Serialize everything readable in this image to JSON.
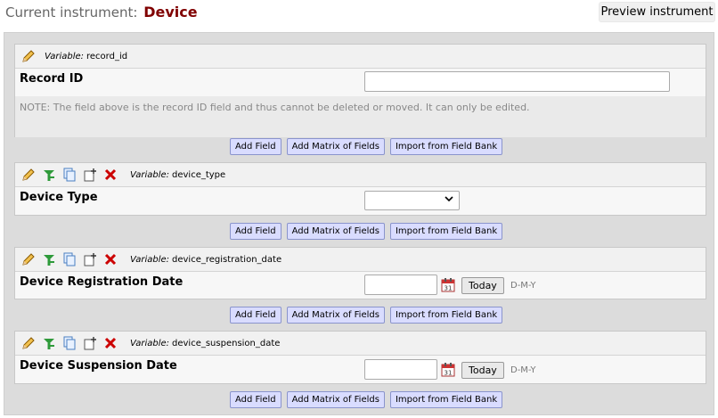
{
  "header": {
    "current_label": "Current instrument:",
    "instrument_name": "Device",
    "preview_button": "Preview instrument"
  },
  "buttons": {
    "add_field": "Add Field",
    "add_matrix": "Add Matrix of Fields",
    "import_bank": "Import from Field Bank"
  },
  "variable_prefix": "Variable:",
  "fields": [
    {
      "variable": "record_id",
      "label": "Record ID",
      "type": "text",
      "value": "",
      "note": "NOTE: The field above is the record ID field and thus cannot be deleted or moved. It can only be edited."
    },
    {
      "variable": "device_type",
      "label": "Device Type",
      "type": "dropdown",
      "selected": ""
    },
    {
      "variable": "device_registration_date",
      "label": "Device Registration Date",
      "type": "date",
      "value": "",
      "today_label": "Today",
      "format": "D-M-Y"
    },
    {
      "variable": "device_suspension_date",
      "label": "Device Suspension Date",
      "type": "date",
      "value": "",
      "today_label": "Today",
      "format": "D-M-Y"
    }
  ],
  "icons": [
    "pencil-icon",
    "branching-icon",
    "copy-icon",
    "move-icon",
    "delete-icon",
    "calendar-icon"
  ],
  "colors": {
    "instrument_name": "#800000",
    "button_bg": "#d9dcff",
    "delete_icon": "#cc0000"
  }
}
